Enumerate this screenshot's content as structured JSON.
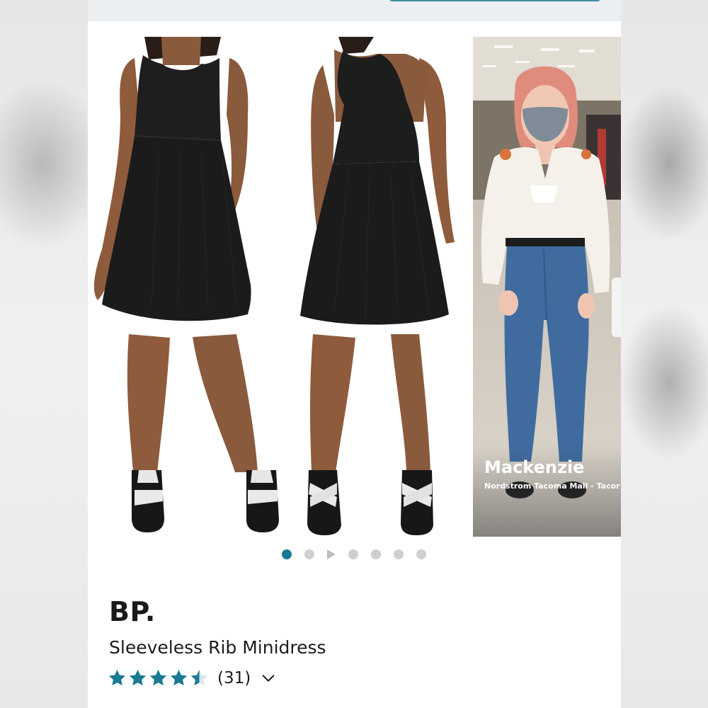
{
  "colors": {
    "accent": "#1a7a93",
    "star_fill": "#1a7a93",
    "dot_inactive": "#cfcfcf"
  },
  "gallery": {
    "slides": [
      {
        "name": "front-view"
      },
      {
        "name": "back-view"
      },
      {
        "name": "video-review"
      }
    ],
    "video": {
      "person_name": "Mackenzie",
      "location": "Nordstrom Tacoma Mall - Tacor"
    },
    "dots": {
      "count": 7,
      "active_index": 0,
      "play_index": 2
    }
  },
  "product": {
    "brand": "BP.",
    "title": "Sleeveless Rib Minidress",
    "rating": {
      "value": 4.5,
      "max": 5,
      "count_label": "(31)"
    }
  },
  "icons": [
    "star-icon",
    "half-star-icon",
    "chevron-down-icon",
    "play-icon"
  ]
}
